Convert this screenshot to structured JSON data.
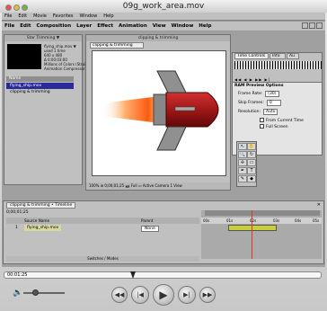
{
  "window": {
    "title": "09g_work_area.mov"
  },
  "winmenu": [
    "File",
    "Edit",
    "Movie",
    "Favorites",
    "Window",
    "Help"
  ],
  "aemenu": [
    "File",
    "Edit",
    "Composition",
    "Layer",
    "Effect",
    "Animation",
    "View",
    "Window",
    "Help"
  ],
  "project": {
    "tab": "Star Trimming ▼",
    "item_name": "flying_ship.mov ▼",
    "info_lines": [
      "used 1 time",
      "640 x 480",
      "Δ 0:00:03:00",
      "Millions of Colors (Straight)",
      "Animation Compressor"
    ],
    "col_name": "Name",
    "items": [
      "flying_ship.mov",
      "clipping & trimming"
    ]
  },
  "comp": {
    "title": "clipping & trimming",
    "tab": "clipping & trimming",
    "toolbar": "100%  ⊞  0;00;01;25  📷  Full  ▭  Active Camera  1 View"
  },
  "time_controls": {
    "tabs": [
      "Time Controls",
      "Info",
      "Au"
    ],
    "buttons": "◀◀  ◀  ▶  ▶▶  ▶|"
  },
  "ram": {
    "title": "RAM Preview Options",
    "frame_rate_label": "Frame Rate:",
    "frame_rate": "(30)",
    "skip_label": "Skip Frames:",
    "skip": "0",
    "res_label": "Resolution:",
    "res": "Auto",
    "from_current": "From Current Time",
    "full_screen": "Full Screen"
  },
  "timeline": {
    "tab": "clipping & trimming • Timeline",
    "current_time": "0;00;01;25",
    "hdr_source": "Source Name",
    "hdr_parent": "Parent",
    "row_num": "1",
    "row_name": "flying_ship.mov",
    "row_parent": "None",
    "ticks": [
      "00s",
      "01s",
      "02s",
      "03s",
      "04s",
      "05s"
    ],
    "footer": "Switches / Modes"
  },
  "player": {
    "time": "00:01:25"
  },
  "tools": [
    "↖",
    "✋",
    "🔍",
    "↻",
    "✢",
    "▭",
    "✒",
    "T",
    "✎",
    "◆"
  ]
}
